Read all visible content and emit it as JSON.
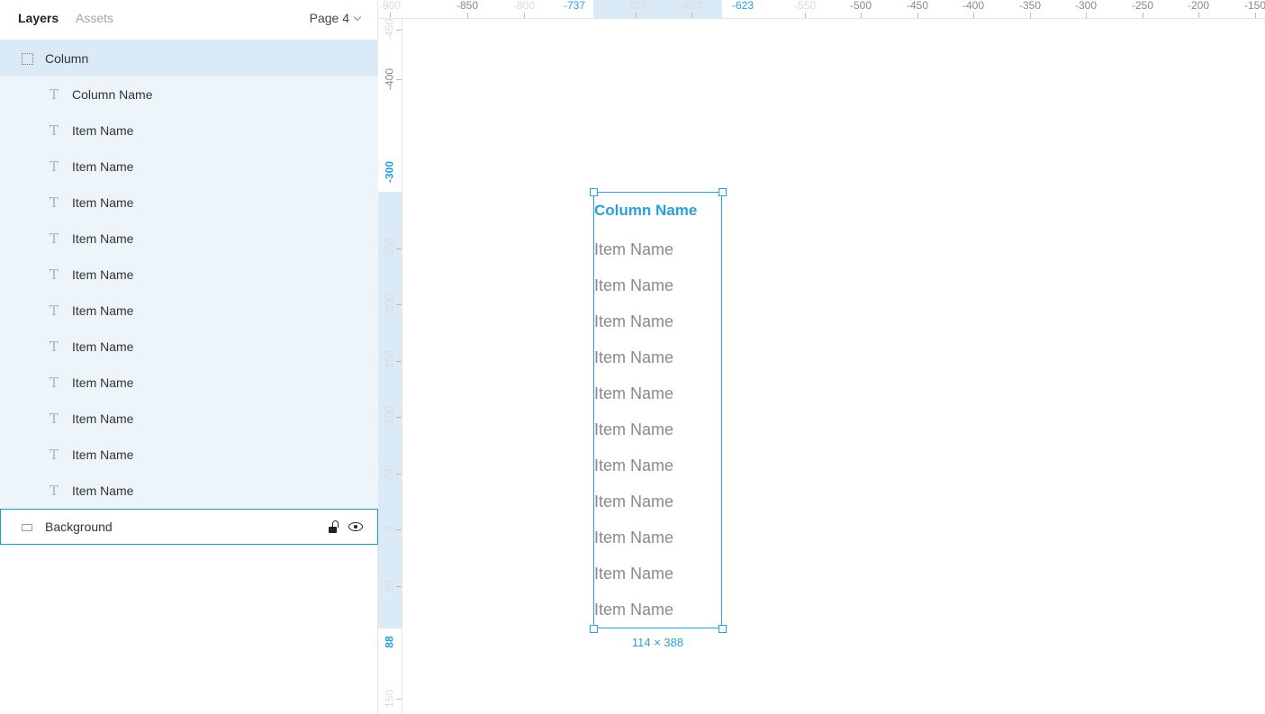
{
  "panel": {
    "tabs": [
      {
        "label": "Layers"
      },
      {
        "label": "Assets"
      }
    ],
    "page_selector": "Page 4",
    "frame_layer": {
      "label": "Column",
      "icon": "frame-icon"
    },
    "child_layers": [
      {
        "label": "Column Name",
        "icon": "text-icon"
      },
      {
        "label": "Item Name",
        "icon": "text-icon"
      },
      {
        "label": "Item Name",
        "icon": "text-icon"
      },
      {
        "label": "Item Name",
        "icon": "text-icon"
      },
      {
        "label": "Item Name",
        "icon": "text-icon"
      },
      {
        "label": "Item Name",
        "icon": "text-icon"
      },
      {
        "label": "Item Name",
        "icon": "text-icon"
      },
      {
        "label": "Item Name",
        "icon": "text-icon"
      },
      {
        "label": "Item Name",
        "icon": "text-icon"
      },
      {
        "label": "Item Name",
        "icon": "text-icon"
      },
      {
        "label": "Item Name",
        "icon": "text-icon"
      },
      {
        "label": "Item Name",
        "icon": "text-icon"
      }
    ],
    "background_layer": {
      "label": "Background",
      "icon": "rectangle-icon",
      "locked": false,
      "visible": true
    },
    "accent_color": "#2a9fd8",
    "selection_color": "#daeaf7"
  },
  "rulers": {
    "horizontal": [
      "-900",
      "-850",
      "-800",
      "-737",
      "-700",
      "-650",
      "-623",
      "-550",
      "-500",
      "-450",
      "-400",
      "-350",
      "-300",
      "-250",
      "-200",
      "-150"
    ],
    "vertical": [
      "-450",
      "-400",
      "-300",
      "-250",
      "-200",
      "-150",
      "-100",
      "-50",
      "0",
      "50",
      "88",
      "150"
    ]
  },
  "canvas": {
    "column": {
      "title": "Column Name",
      "items": [
        "Item Name",
        "Item Name",
        "Item Name",
        "Item Name",
        "Item Name",
        "Item Name",
        "Item Name",
        "Item Name",
        "Item Name",
        "Item Name",
        "Item Name"
      ]
    },
    "size_label": "114 × 388"
  }
}
